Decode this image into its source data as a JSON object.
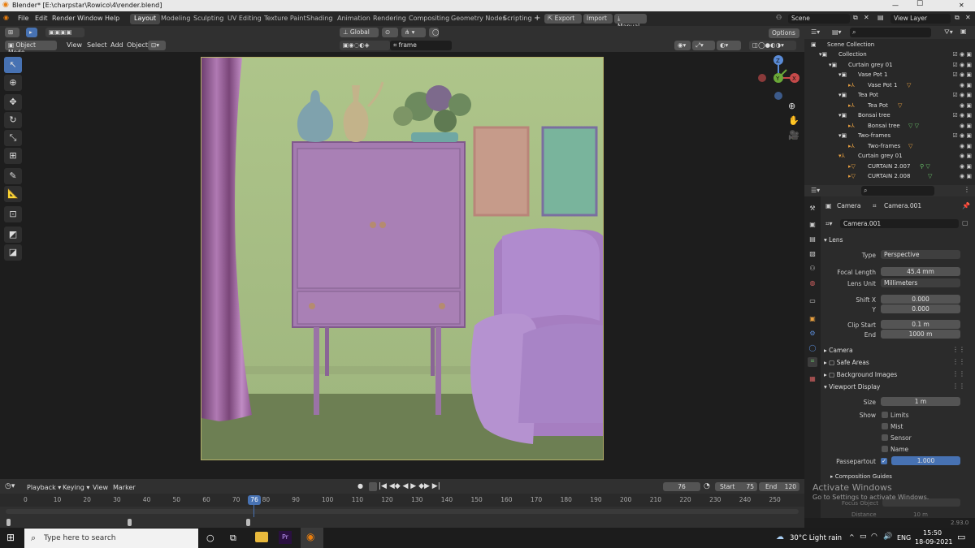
{
  "window": {
    "title": "Blender* [E:\\charpstar\\Rowico\\4\\render.blend]",
    "minimize": "—",
    "maximize": "☐",
    "close": "✕"
  },
  "menu": [
    "File",
    "Edit",
    "Render",
    "Window",
    "Help"
  ],
  "workspaces": [
    "Layout",
    "Modeling",
    "Sculpting",
    "UV Editing",
    "Texture Paint",
    "Shading",
    "Animation",
    "Rendering",
    "Compositing",
    "Geometry Nodes",
    "Scripting"
  ],
  "header_actions": {
    "plus": "+",
    "export": "Export",
    "import": "Import",
    "manual": "Manual"
  },
  "scene": {
    "label": "Scene",
    "view_layer": "View Layer"
  },
  "viewport": {
    "mode": "Object Mode",
    "menus": [
      "View",
      "Select",
      "Add",
      "Object"
    ],
    "transform": "Global",
    "camera_name": "frame",
    "options": "Options",
    "gizmo": {
      "x": "X",
      "y": "Y",
      "z": "Z"
    }
  },
  "tools": [
    "select",
    "cursor",
    "move",
    "rotate",
    "scale",
    "transform",
    "annotate",
    "measure",
    "add-cube",
    "shear",
    "transform-box"
  ],
  "outliner": {
    "rows": [
      {
        "indent": 0,
        "label": "Scene Collection"
      },
      {
        "indent": 1,
        "label": "Collection"
      },
      {
        "indent": 2,
        "label": "Curtain grey 01"
      },
      {
        "indent": 3,
        "label": "Vase Pot 1"
      },
      {
        "indent": 4,
        "label": "Vase Pot 1"
      },
      {
        "indent": 3,
        "label": "Tea Pot"
      },
      {
        "indent": 4,
        "label": "Tea Pot"
      },
      {
        "indent": 3,
        "label": "Bonsai tree"
      },
      {
        "indent": 4,
        "label": "Bonsai tree"
      },
      {
        "indent": 3,
        "label": "Two-frames"
      },
      {
        "indent": 4,
        "label": "Two-frames"
      },
      {
        "indent": 3,
        "label": "Curtain grey 01"
      },
      {
        "indent": 4,
        "label": "CURTAIN 2.007"
      },
      {
        "indent": 4,
        "label": "CURTAIN 2.008"
      }
    ]
  },
  "properties": {
    "breadcrumb_object": "Camera",
    "breadcrumb_data": "Camera.001",
    "data_name": "Camera.001",
    "lens_section": "Lens",
    "type_label": "Type",
    "type_value": "Perspective",
    "focal_label": "Focal Length",
    "focal_value": "45.4 mm",
    "lens_unit_label": "Lens Unit",
    "lens_unit_value": "Millimeters",
    "shiftx_label": "Shift X",
    "shiftx_value": "0.000",
    "shifty_label": "Y",
    "shifty_value": "0.000",
    "clipstart_label": "Clip Start",
    "clipstart_value": "0.1 m",
    "clipend_label": "End",
    "clipend_value": "1000 m",
    "camera_section": "Camera",
    "safe_areas": "Safe Areas",
    "background_images": "Background Images",
    "viewport_display": "Viewport Display",
    "size_label": "Size",
    "size_value": "1 m",
    "show_label": "Show",
    "limits": "Limits",
    "mist": "Mist",
    "sensor": "Sensor",
    "name": "Name",
    "passepartout_label": "Passepartout",
    "passepartout_value": "1.000",
    "composition_guides": "Composition Guides",
    "focus_object": "Focus Object",
    "distance_label": "Distance",
    "distance_value": "10 m",
    "version": "2.93.0"
  },
  "activate": {
    "line1": "Activate Windows",
    "line2": "Go to Settings to activate Windows."
  },
  "timeline": {
    "menus": [
      "Playback",
      "Keying",
      "View",
      "Marker"
    ],
    "current_frame": "76",
    "start_label": "Start",
    "start_value": "75",
    "end_label": "End",
    "end_value": "120",
    "ticks": [
      "0",
      "10",
      "20",
      "30",
      "40",
      "50",
      "60",
      "70",
      "80",
      "90",
      "100",
      "110",
      "120",
      "130",
      "140",
      "150",
      "160",
      "170",
      "180",
      "190",
      "200",
      "210",
      "220",
      "230",
      "240",
      "250"
    ],
    "playhead_fraction": 0.304
  },
  "taskbar": {
    "search_placeholder": "Type here to search",
    "weather": "30°C  Light rain",
    "lang": "ENG",
    "time": "15:50",
    "date": "18-09-2021",
    "tray_chevron": "^"
  }
}
